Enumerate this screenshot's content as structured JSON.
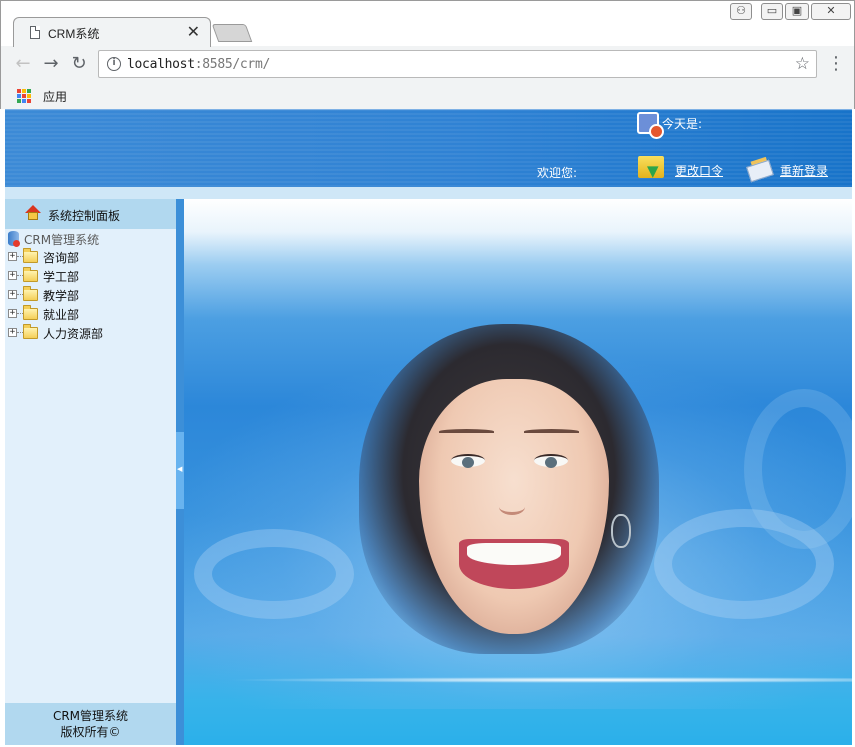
{
  "browser": {
    "tab_title": "CRM系统",
    "tab_close": "✕",
    "url_host": "localhost",
    "url_rest": ":8585/crm/",
    "bookmarks_apps_label": "应用"
  },
  "header": {
    "today_label": "今天是:",
    "welcome_label": "欢迎您:",
    "change_password_link": "更改口令",
    "relogin_link": "重新登录"
  },
  "sidebar": {
    "title": "系统控制面板",
    "tree_root": "CRM管理系统",
    "departments": [
      "咨询部",
      "学工部",
      "教学部",
      "就业部",
      "人力资源部"
    ],
    "footer_line1": "CRM管理系统",
    "footer_line2": "版权所有©"
  },
  "icons": {
    "apps_grid_colors": [
      "#ea4335",
      "#fbbc05",
      "#34a853",
      "#4285f4",
      "#ea4335",
      "#fbbc05",
      "#34a853",
      "#4285f4",
      "#ea4335"
    ]
  }
}
